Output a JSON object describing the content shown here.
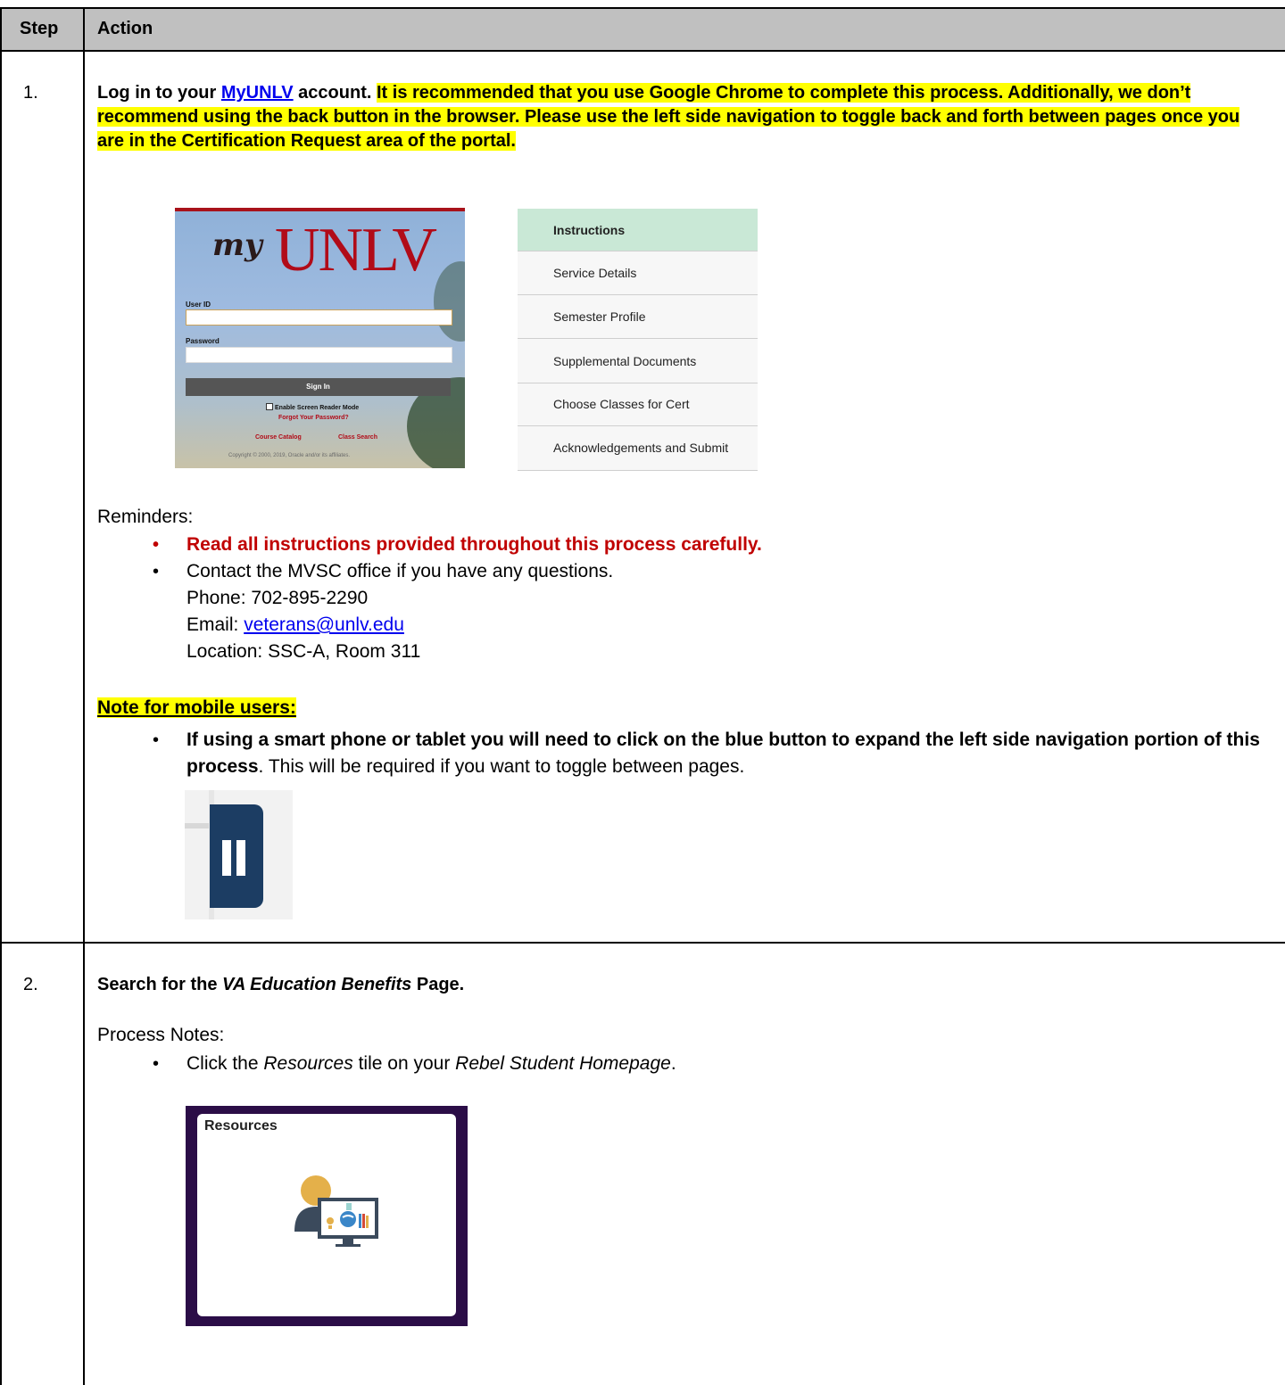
{
  "table": {
    "header_step": "Step",
    "header_action": "Action"
  },
  "step1": {
    "num": "1.",
    "intro_before": "Log in to your ",
    "link": "MyUNLV",
    "intro_after": " account. ",
    "highlight": "It is recommended that you use Google Chrome to complete this process. Additionally, we don’t recommend using the back button in the browser. Please use the left side navigation to toggle back and forth between pages once you are in the Certification Request area of the portal.",
    "login": {
      "logo_my": "my",
      "logo_unlv": "UNLV",
      "user_id_label": "User ID",
      "password_label": "Password",
      "sign_in": "Sign In",
      "screen_reader": "Enable Screen Reader Mode",
      "forgot": "Forgot Your Password?",
      "course_catalog": "Course Catalog",
      "class_search": "Class Search",
      "copyright": "Copyright © 2000, 2019, Oracle and/or its affiliates."
    },
    "nav": [
      "Instructions",
      "Service Details",
      "Semester Profile",
      "Supplemental Documents",
      "Choose Classes for Cert",
      "Acknowledgements and Submit"
    ],
    "reminders_label": "Reminders:",
    "reminder1": "Read all instructions provided throughout this process carefully.",
    "reminder2": "Contact the MVSC office if you have any questions.",
    "phone": "Phone: 702-895-2290",
    "email_label": "Email: ",
    "email": "veterans@unlv.edu",
    "location": "Location: SSC-A, Room 311",
    "mobile_heading": "Note for mobile users:",
    "mobile_bold": "If using a smart phone or tablet you will need to click on the blue button to expand the left side navigation portion of this process",
    "mobile_rest": ". This will be required if you want to toggle between pages."
  },
  "step2": {
    "num": "2.",
    "title_a": "Search for the ",
    "title_italic": "VA Education Benefits",
    "title_b": " Page.",
    "process_notes": "Process Notes:",
    "note_a": "Click the ",
    "note_i1": "Resources",
    "note_b": " tile on your ",
    "note_i2": "Rebel Student Homepage",
    "note_c": ".",
    "tile_title": "Resources"
  },
  "colors": {
    "header_bg": "#c0c0c0",
    "highlight": "#ffff00",
    "reminder_red": "#c00000",
    "link_blue": "#0000ee",
    "nav_active": "#c9e8d6",
    "tile_border": "#2b0d47"
  }
}
